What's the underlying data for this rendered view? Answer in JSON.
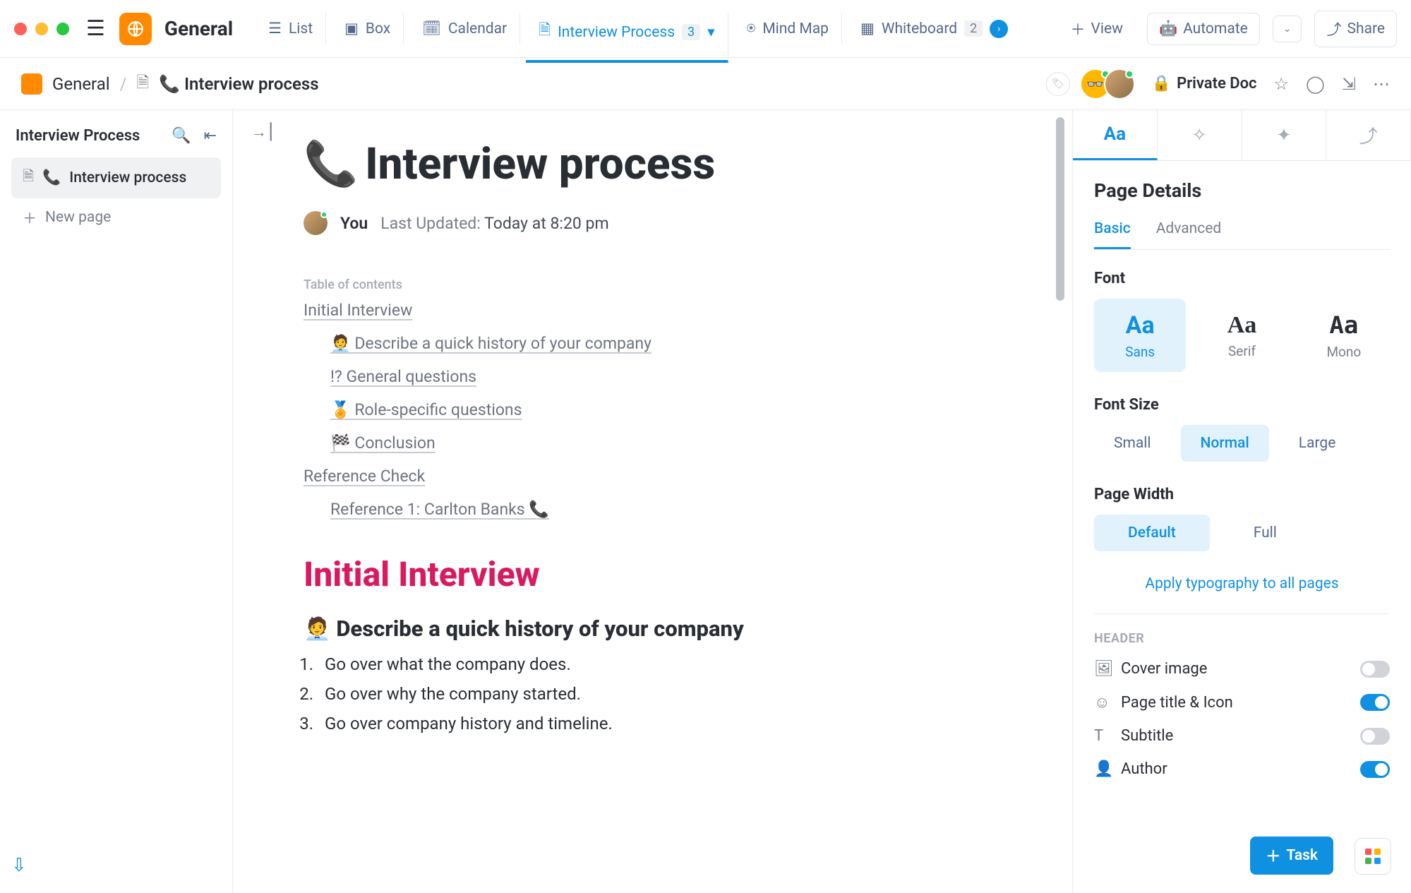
{
  "workspace": {
    "name": "General"
  },
  "view_tabs": [
    {
      "icon": "list",
      "label": "List"
    },
    {
      "icon": "box",
      "label": "Box"
    },
    {
      "icon": "cal",
      "label": "Calendar"
    },
    {
      "icon": "doc",
      "label": "Interview Process",
      "badge": "3",
      "active": true,
      "chev": true
    },
    {
      "icon": "mind",
      "label": "Mind Map"
    },
    {
      "icon": "wb",
      "label": "Whiteboard",
      "badge": "2",
      "next": true
    }
  ],
  "top_right": {
    "view": "View",
    "automate": "Automate",
    "share": "Share"
  },
  "breadcrumb": {
    "root": "General",
    "doc": "📞 Interview process"
  },
  "privacy": "Private Doc",
  "sidebar": {
    "title": "Interview Process",
    "items": [
      {
        "label": "Interview process",
        "emoji": "📞",
        "selected": true
      }
    ],
    "new_page": "New page"
  },
  "doc": {
    "title_emoji": "📞",
    "title": "Interview process",
    "author": "You",
    "updated_label": "Last Updated:",
    "updated_value": "Today at 8:20 pm",
    "toc_label": "Table of contents",
    "toc": [
      {
        "t": "Initial Interview",
        "lvl": 0
      },
      {
        "t": "🧑‍💼 Describe a quick history of your company",
        "lvl": 1
      },
      {
        "t": "!? General questions",
        "lvl": 1
      },
      {
        "t": "🏅 Role-specific questions",
        "lvl": 1
      },
      {
        "t": "🏁 Conclusion",
        "lvl": 1
      },
      {
        "t": "Reference Check",
        "lvl": 0
      },
      {
        "t": "Reference 1: Carlton Banks 📞",
        "lvl": 1
      }
    ],
    "h1": "Initial Interview",
    "h2": "🧑‍💼 Describe a quick history of your company",
    "list": [
      "Go over what the company does.",
      "Go over why the company started.",
      "Go over company history and timeline."
    ]
  },
  "panel": {
    "title": "Page Details",
    "tabs": {
      "basic": "Basic",
      "advanced": "Advanced"
    },
    "font_label": "Font",
    "fonts": [
      {
        "l": "Sans",
        "sel": true
      },
      {
        "l": "Serif"
      },
      {
        "l": "Mono"
      }
    ],
    "size_label": "Font Size",
    "sizes": [
      {
        "l": "Small"
      },
      {
        "l": "Normal",
        "sel": true
      },
      {
        "l": "Large"
      }
    ],
    "width_label": "Page Width",
    "widths": [
      {
        "l": "Default",
        "sel": true
      },
      {
        "l": "Full"
      }
    ],
    "apply": "Apply typography to all pages",
    "header_label": "HEADER",
    "toggles": [
      {
        "l": "Cover image",
        "on": false,
        "i": "img"
      },
      {
        "l": "Page title & Icon",
        "on": true,
        "i": "smile"
      },
      {
        "l": "Subtitle",
        "on": false,
        "i": "sub"
      },
      {
        "l": "Author",
        "on": true,
        "i": "user"
      }
    ]
  },
  "fab": "Task"
}
